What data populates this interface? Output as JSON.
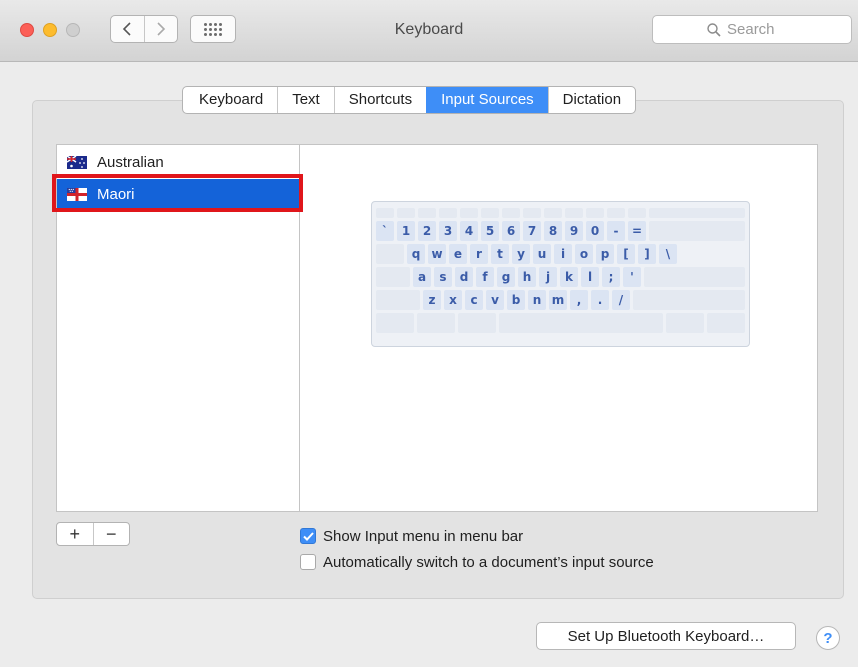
{
  "window": {
    "title": "Keyboard",
    "search_placeholder": "Search"
  },
  "tabs": [
    {
      "label": "Keyboard",
      "active": false
    },
    {
      "label": "Text",
      "active": false
    },
    {
      "label": "Shortcuts",
      "active": false
    },
    {
      "label": "Input Sources",
      "active": true
    },
    {
      "label": "Dictation",
      "active": false
    }
  ],
  "input_sources": [
    {
      "label": "Australian",
      "selected": false,
      "flag": "australia-flag-icon"
    },
    {
      "label": "Maori",
      "selected": true,
      "flag": "new-zealand-flag-icon"
    }
  ],
  "keyboard_preview": {
    "row1": [
      "`",
      "1",
      "2",
      "3",
      "4",
      "5",
      "6",
      "7",
      "8",
      "9",
      "0",
      "-",
      "="
    ],
    "row2": [
      "q",
      "w",
      "e",
      "r",
      "t",
      "y",
      "u",
      "i",
      "o",
      "p",
      "[",
      "]",
      "\\"
    ],
    "row3": [
      "a",
      "s",
      "d",
      "f",
      "g",
      "h",
      "j",
      "k",
      "l",
      ";",
      "'"
    ],
    "row4": [
      "z",
      "x",
      "c",
      "v",
      "b",
      "n",
      "m",
      ",",
      ".",
      "/"
    ]
  },
  "buttons": {
    "add": "+",
    "remove": "−",
    "bluetooth": "Set Up Bluetooth Keyboard…",
    "help": "?"
  },
  "options": {
    "show_input_menu": {
      "label": "Show Input menu in menu bar",
      "checked": true
    },
    "auto_switch": {
      "label": "Automatically switch to a document’s input source",
      "checked": false
    }
  },
  "colors": {
    "accent": "#3e8ef7",
    "selection": "#1463d9",
    "highlight_border": "#e0161b"
  }
}
